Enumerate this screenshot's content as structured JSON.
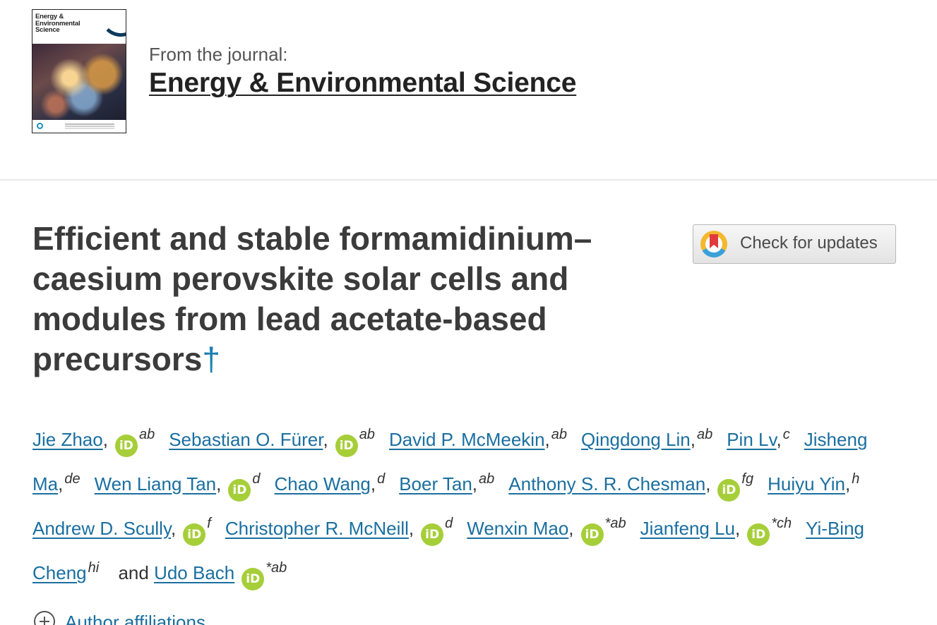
{
  "journal": {
    "cover_title": "Energy & Environmental Science",
    "from_label": "From the journal:",
    "name": "Energy & Environmental Science"
  },
  "article": {
    "title": "Efficient and stable formamidinium–caesium perovskite solar cells and modules from lead acetate-based precursors",
    "dagger": "†"
  },
  "check_updates": {
    "label": "Check for updates"
  },
  "authors": [
    {
      "name": "Jie Zhao",
      "orcid": true,
      "sup": "ab"
    },
    {
      "name": "Sebastian O. Fürer",
      "orcid": true,
      "sup": "ab"
    },
    {
      "name": "David P. McMeekin",
      "orcid": false,
      "sup": "ab"
    },
    {
      "name": "Qingdong Lin",
      "orcid": false,
      "sup": "ab"
    },
    {
      "name": "Pin Lv",
      "orcid": false,
      "sup": "c"
    },
    {
      "name": "Jisheng Ma",
      "orcid": false,
      "sup": "de"
    },
    {
      "name": "Wen Liang Tan",
      "orcid": true,
      "sup": "d"
    },
    {
      "name": "Chao Wang",
      "orcid": false,
      "sup": "d"
    },
    {
      "name": "Boer Tan",
      "orcid": false,
      "sup": "ab"
    },
    {
      "name": "Anthony S. R. Chesman",
      "orcid": true,
      "sup": "fg"
    },
    {
      "name": "Huiyu Yin",
      "orcid": false,
      "sup": "h"
    },
    {
      "name": "Andrew D. Scully",
      "orcid": true,
      "sup": "f"
    },
    {
      "name": "Christopher R. McNeill",
      "orcid": true,
      "sup": "d"
    },
    {
      "name": "Wenxin Mao",
      "orcid": true,
      "sup": "*ab"
    },
    {
      "name": "Jianfeng Lu",
      "orcid": true,
      "sup": "*ch"
    },
    {
      "name": "Yi-Bing Cheng",
      "orcid": false,
      "sup": "hi"
    },
    {
      "name": "Udo Bach",
      "orcid": true,
      "sup": "*ab"
    }
  ],
  "orcid_icon_text": "iD",
  "and_word": "and",
  "affiliations": {
    "label": "Author affiliations"
  }
}
